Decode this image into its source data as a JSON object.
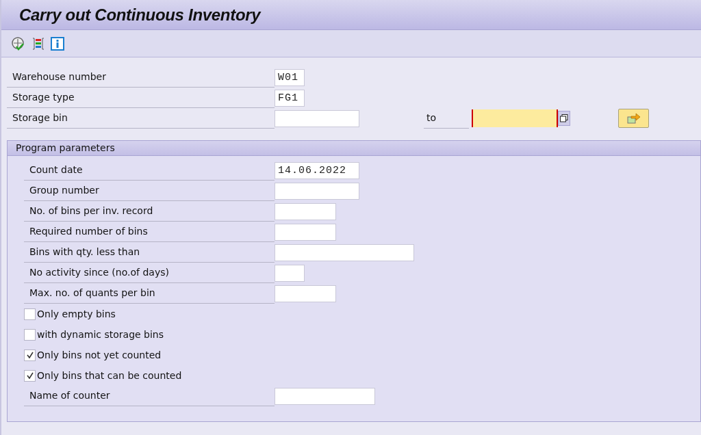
{
  "window": {
    "title": "Carry out Continuous Inventory"
  },
  "selection": [
    {
      "label": "Warehouse number",
      "value": "W01"
    },
    {
      "label": "Storage type",
      "value": "FG1"
    },
    {
      "label": "Storage bin",
      "to_label": "to"
    }
  ],
  "program_parameters": {
    "title": "Program parameters",
    "rows": [
      {
        "kind": "field",
        "label": "Count date",
        "value": "14.06.2022"
      },
      {
        "kind": "field",
        "label": "Group number"
      },
      {
        "kind": "field",
        "label": "No. of bins per inv. record"
      },
      {
        "kind": "field",
        "label": "Required number of bins"
      },
      {
        "kind": "field",
        "label": "Bins with qty. less than"
      },
      {
        "kind": "field",
        "label": "No activity since (no.of days)"
      },
      {
        "kind": "field",
        "label": "Max. no. of quants per bin"
      },
      {
        "kind": "checkbox",
        "label": "Only empty bins",
        "checked": false
      },
      {
        "kind": "checkbox",
        "label": "with dynamic storage bins",
        "checked": false
      },
      {
        "kind": "checkbox",
        "label": "Only bins not yet counted",
        "checked": true
      },
      {
        "kind": "checkbox",
        "label": "Only bins that can be counted",
        "checked": true
      },
      {
        "kind": "field",
        "label": "Name of counter"
      }
    ]
  }
}
